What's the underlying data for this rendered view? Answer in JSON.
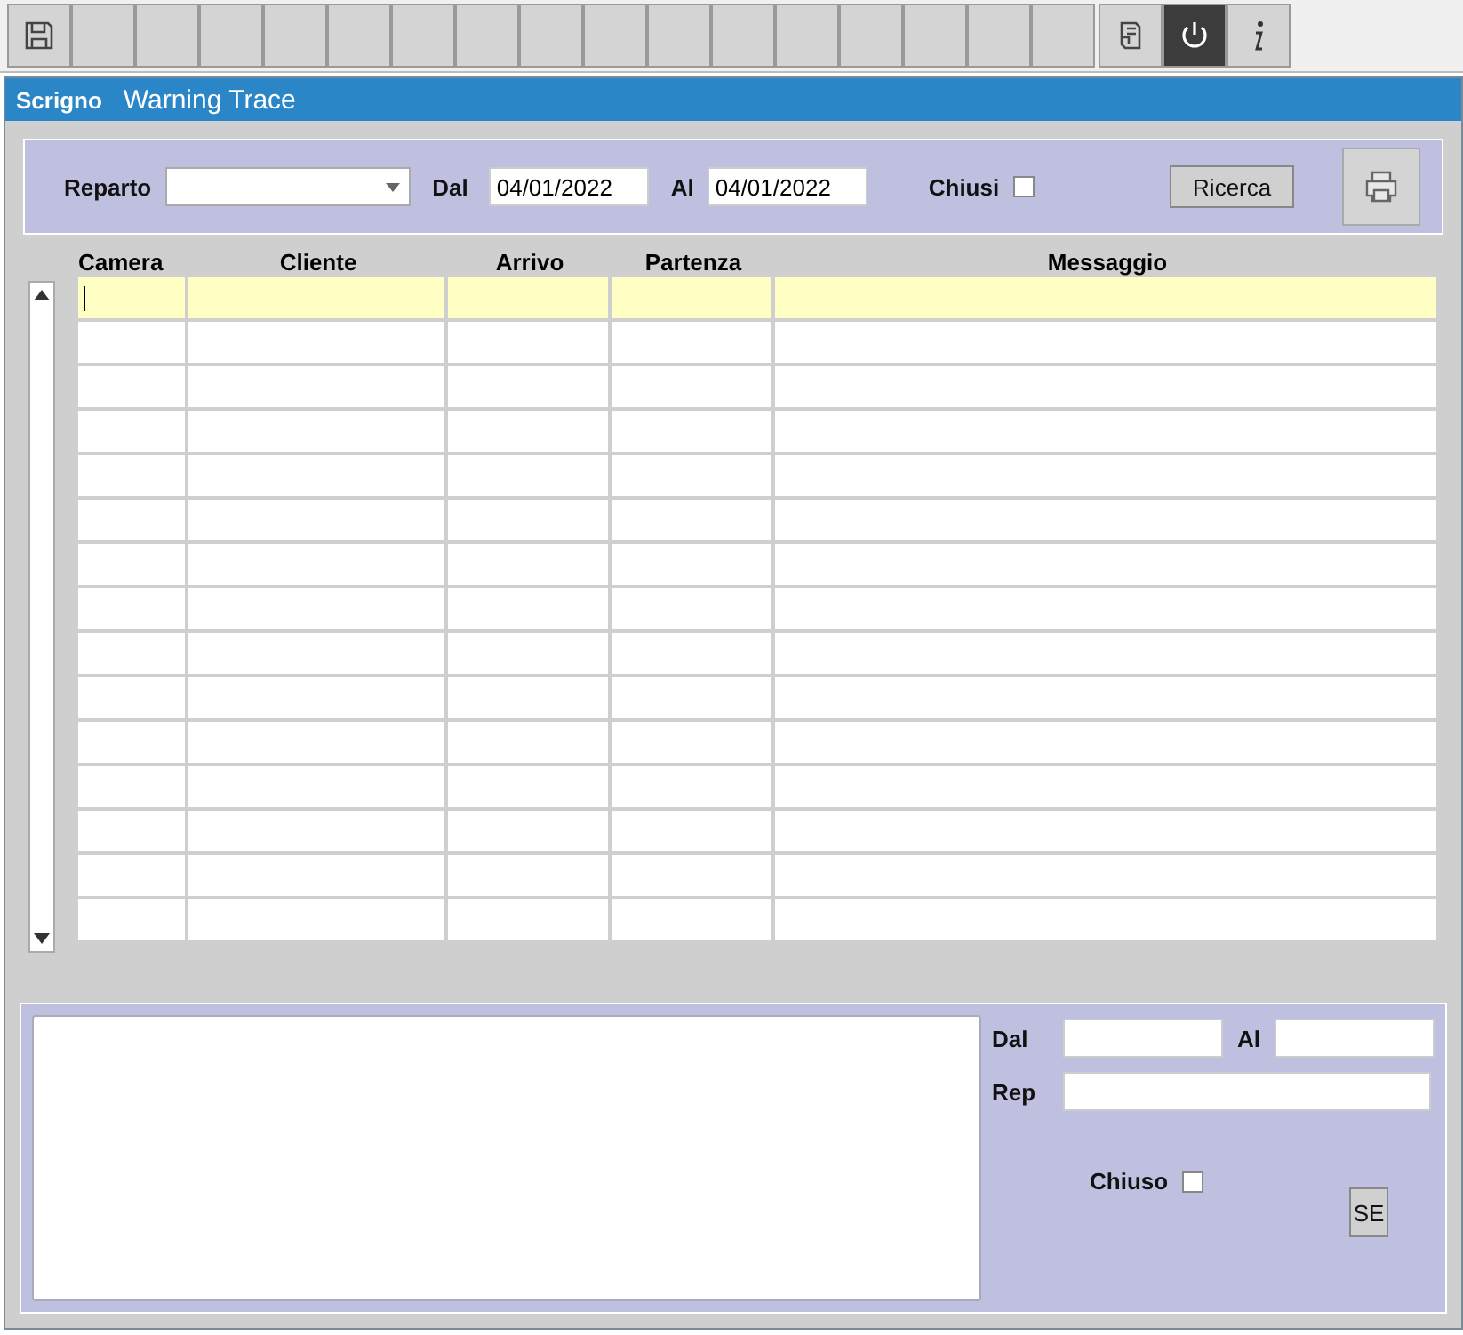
{
  "toolbar": [
    {
      "kind": "save"
    },
    {
      "kind": "blank"
    },
    {
      "kind": "blank"
    },
    {
      "kind": "blank"
    },
    {
      "kind": "blank"
    },
    {
      "kind": "blank"
    },
    {
      "kind": "blank"
    },
    {
      "kind": "blank"
    },
    {
      "kind": "blank"
    },
    {
      "kind": "blank"
    },
    {
      "kind": "blank"
    },
    {
      "kind": "blank"
    },
    {
      "kind": "blank"
    },
    {
      "kind": "blank"
    },
    {
      "kind": "blank"
    },
    {
      "kind": "blank"
    },
    {
      "kind": "blank"
    },
    {
      "kind": "document"
    },
    {
      "kind": "power"
    },
    {
      "kind": "info"
    }
  ],
  "window": {
    "brand": "Scrigno",
    "title": "Warning Trace"
  },
  "filters": {
    "reparto_label": "Reparto",
    "dal_label": "Dal",
    "dal_value": "04/01/2022",
    "al_label": "Al",
    "al_value": "04/01/2022",
    "chiusi_label": "Chiusi",
    "chiusi_checked": false,
    "search_button": "Ricerca"
  },
  "table": {
    "columns": [
      "Camera",
      "Cliente",
      "Arrivo",
      "Partenza",
      "Messaggio"
    ],
    "rows": [
      {
        "selected": true
      },
      {
        "selected": false
      },
      {
        "selected": false
      },
      {
        "selected": false
      },
      {
        "selected": false
      },
      {
        "selected": false
      },
      {
        "selected": false
      },
      {
        "selected": false
      },
      {
        "selected": false
      },
      {
        "selected": false
      },
      {
        "selected": false
      },
      {
        "selected": false
      },
      {
        "selected": false
      },
      {
        "selected": false
      },
      {
        "selected": false
      }
    ]
  },
  "detail": {
    "dal_label": "Dal",
    "al_label": "Al",
    "rep_label": "Rep",
    "chiuso_label": "Chiuso",
    "chiuso_checked": false,
    "button": "SE"
  }
}
